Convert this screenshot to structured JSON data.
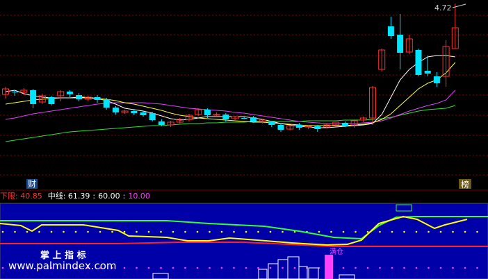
{
  "main_panel": {
    "price_label": "4.72",
    "badge_left": "财",
    "badge_right": "榜"
  },
  "indicator_header": {
    "lower_label": "下限: ",
    "lower_value": "40.85",
    "mid_label": "中线: ",
    "mid_value": "61.39",
    "val_a": "60.00",
    "val_b": "10.00"
  },
  "watermark": {
    "line1": "掌 上 指 标",
    "line2": "www.palmindex.com"
  },
  "annotation": "满仓",
  "colors": {
    "up": "#ff3030",
    "down": "#00e5ff",
    "ma_white": "#ffffff",
    "ma_yellow": "#ffff40",
    "ma_magenta": "#e040ff",
    "ma_green": "#30e030",
    "grid": "#8b0000",
    "panel_bg": "#0000a8",
    "lower_red": "#ff2020",
    "upper_green": "#30ff30",
    "dot_yellow": "#ffff00",
    "dot_magenta": "#ff40ff"
  },
  "chart_data": {
    "type": "candlestick",
    "candles": [
      [
        136,
        128,
        125,
        142
      ],
      [
        132,
        133,
        130,
        138
      ],
      [
        133,
        130,
        127,
        137
      ],
      [
        130,
        150,
        128,
        156
      ],
      [
        147,
        138,
        135,
        150
      ],
      [
        140,
        150,
        138,
        152
      ],
      [
        138,
        132,
        130,
        146
      ],
      [
        132,
        136,
        130,
        140
      ],
      [
        137,
        143,
        134,
        146
      ],
      [
        143,
        140,
        138,
        146
      ],
      [
        140,
        144,
        137,
        148
      ],
      [
        143,
        155,
        141,
        158
      ],
      [
        155,
        162,
        153,
        165
      ],
      [
        162,
        160,
        158,
        164
      ],
      [
        160,
        163,
        157,
        166
      ],
      [
        162,
        166,
        160,
        168
      ],
      [
        163,
        173,
        161,
        175
      ],
      [
        175,
        180,
        172,
        182
      ],
      [
        180,
        176,
        174,
        183
      ],
      [
        176,
        172,
        170,
        178
      ],
      [
        172,
        166,
        164,
        175
      ],
      [
        165,
        158,
        156,
        167
      ],
      [
        158,
        166,
        156,
        170
      ],
      [
        166,
        165,
        162,
        168
      ],
      [
        165,
        172,
        163,
        175
      ],
      [
        171,
        168,
        167,
        173
      ],
      [
        170,
        170,
        168,
        172
      ],
      [
        169,
        175,
        167,
        177
      ],
      [
        175,
        173,
        171,
        178
      ],
      [
        176,
        180,
        174,
        183
      ],
      [
        180,
        187,
        178,
        190
      ],
      [
        186,
        181,
        180,
        188
      ],
      [
        180,
        184,
        177,
        187
      ],
      [
        183,
        182,
        181,
        186
      ],
      [
        182,
        186,
        180,
        190
      ],
      [
        183,
        180,
        178,
        185
      ],
      [
        180,
        176,
        178,
        182
      ],
      [
        177,
        182,
        175,
        183
      ],
      [
        180,
        174,
        172,
        184
      ],
      [
        173,
        170,
        168,
        176
      ],
      [
        170,
        126,
        124,
        180
      ],
      [
        100,
        72,
        70,
        103
      ],
      [
        38,
        52,
        24,
        56
      ],
      [
        50,
        76,
        20,
        100
      ],
      [
        75,
        56,
        50,
        78
      ],
      [
        72,
        108,
        70,
        110
      ],
      [
        102,
        106,
        80,
        110
      ],
      [
        110,
        120,
        104,
        125
      ],
      [
        110,
        67,
        58,
        125
      ],
      [
        70,
        40,
        5,
        70
      ]
    ],
    "ma_white": [
      132,
      130,
      135,
      138,
      140,
      141,
      141,
      141,
      140,
      140,
      142,
      145,
      150,
      156,
      158,
      160,
      163,
      167,
      171,
      173,
      172,
      170,
      168,
      168,
      168,
      168,
      168,
      170,
      172,
      175,
      178,
      180,
      182,
      183,
      184,
      184,
      183,
      182,
      181,
      180,
      178,
      165,
      140,
      115,
      100,
      90,
      82,
      80,
      80,
      82
    ],
    "ma_yellow": [
      150,
      148,
      146,
      144,
      143,
      142,
      141,
      141,
      141,
      141,
      142,
      143,
      145,
      148,
      150,
      153,
      156,
      159,
      163,
      166,
      168,
      170,
      171,
      172,
      173,
      174,
      175,
      176,
      176,
      177,
      178,
      179,
      180,
      181,
      181,
      181,
      181,
      181,
      180,
      179,
      177,
      172,
      164,
      152,
      140,
      128,
      120,
      115,
      105,
      90
    ],
    "ma_magenta": [
      172,
      170,
      167,
      164,
      162,
      160,
      158,
      156,
      154,
      152,
      150,
      149,
      148,
      148,
      148,
      148,
      149,
      150,
      152,
      154,
      156,
      157,
      158,
      159,
      160,
      162,
      163,
      165,
      167,
      169,
      171,
      173,
      175,
      176,
      177,
      178,
      178,
      178,
      178,
      177,
      176,
      174,
      170,
      165,
      160,
      156,
      152,
      149,
      144,
      130
    ],
    "ma_green": [
      204,
      202,
      200,
      198,
      196,
      194,
      192,
      190,
      189,
      188,
      187,
      186,
      185,
      184,
      183,
      182,
      181,
      181,
      180,
      179,
      178,
      178,
      177,
      177,
      176,
      176,
      176,
      175,
      175,
      175,
      175,
      175,
      175,
      174,
      174,
      174,
      174,
      173,
      173,
      173,
      172,
      171,
      169,
      166,
      163,
      160,
      158,
      157,
      156,
      152
    ],
    "indicator": {
      "lower": 40.85,
      "mid": 61.39,
      "upper": 60.0,
      "baseline": 10.0
    }
  }
}
